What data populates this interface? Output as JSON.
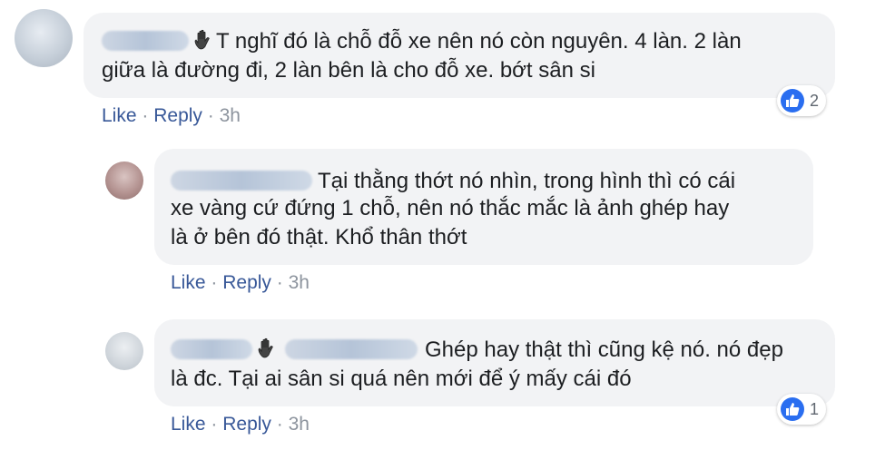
{
  "comments": [
    {
      "text_line1": "T nghĩ đó là chỗ đỗ xe nên nó còn nguyên. 4 làn. 2 làn",
      "text_line2": "giữa là đường đi, 2 làn bên là cho đỗ xe. bớt sân si",
      "like_label": "Like",
      "reply_label": "Reply",
      "separator": "·",
      "time": "3h",
      "reaction_count": "2"
    },
    {
      "text_line1": "Tại thằng thớt nó nhìn, trong hình thì có cái",
      "text_line2": "xe vàng cứ đứng 1 chỗ, nên nó thắc mắc là ảnh ghép hay",
      "text_line3": "là ở bên đó thật. Khổ thân thớt",
      "like_label": "Like",
      "reply_label": "Reply",
      "separator": "·",
      "time": "3h"
    },
    {
      "text_line1": "Ghép hay thật thì cũng kệ nó. nó đẹp",
      "text_line2": "là đc. Tại ai sân si quá nên mới để ý mấy cái đó",
      "like_label": "Like",
      "reply_label": "Reply",
      "separator": "·",
      "time": "3h",
      "reaction_count": "1"
    }
  ],
  "colors": {
    "bubble": "#f2f3f5",
    "link": "#385898",
    "meta": "#8d949e",
    "like_badge": "#2a6ef0"
  },
  "icons": [
    "waving-hand-icon",
    "thumbs-up-icon"
  ]
}
